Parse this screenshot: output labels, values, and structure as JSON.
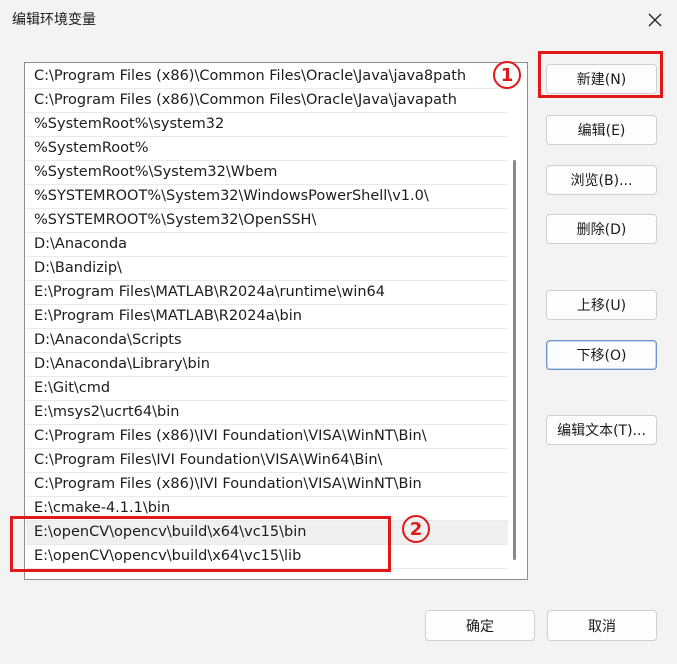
{
  "window": {
    "title": "编辑环境变量"
  },
  "path_entries": [
    "C:\\Program Files (x86)\\Common Files\\Oracle\\Java\\java8path",
    "C:\\Program Files (x86)\\Common Files\\Oracle\\Java\\javapath",
    "%SystemRoot%\\system32",
    "%SystemRoot%",
    "%SystemRoot%\\System32\\Wbem",
    "%SYSTEMROOT%\\System32\\WindowsPowerShell\\v1.0\\",
    "%SYSTEMROOT%\\System32\\OpenSSH\\",
    "D:\\Anaconda",
    "D:\\Bandizip\\",
    "E:\\Program Files\\MATLAB\\R2024a\\runtime\\win64",
    "E:\\Program Files\\MATLAB\\R2024a\\bin",
    "D:\\Anaconda\\Scripts",
    "D:\\Anaconda\\Library\\bin",
    "E:\\Git\\cmd",
    "E:\\msys2\\ucrt64\\bin",
    "C:\\Program Files (x86)\\IVI Foundation\\VISA\\WinNT\\Bin\\",
    "C:\\Program Files\\IVI Foundation\\VISA\\Win64\\Bin\\",
    "C:\\Program Files (x86)\\IVI Foundation\\VISA\\WinNT\\Bin",
    "E:\\cmake-4.1.1\\bin",
    "E:\\openCV\\opencv\\build\\x64\\vc15\\bin",
    "E:\\openCV\\opencv\\build\\x64\\vc15\\lib"
  ],
  "selected_index": 19,
  "buttons": {
    "new": "新建(N)",
    "edit": "编辑(E)",
    "browse": "浏览(B)...",
    "delete": "删除(D)",
    "move_up": "上移(U)",
    "move_down": "下移(O)",
    "edit_text": "编辑文本(T)...",
    "ok": "确定",
    "cancel": "取消"
  },
  "annotations": {
    "marker_1": "1",
    "marker_2": "2",
    "color": "#e01818"
  }
}
